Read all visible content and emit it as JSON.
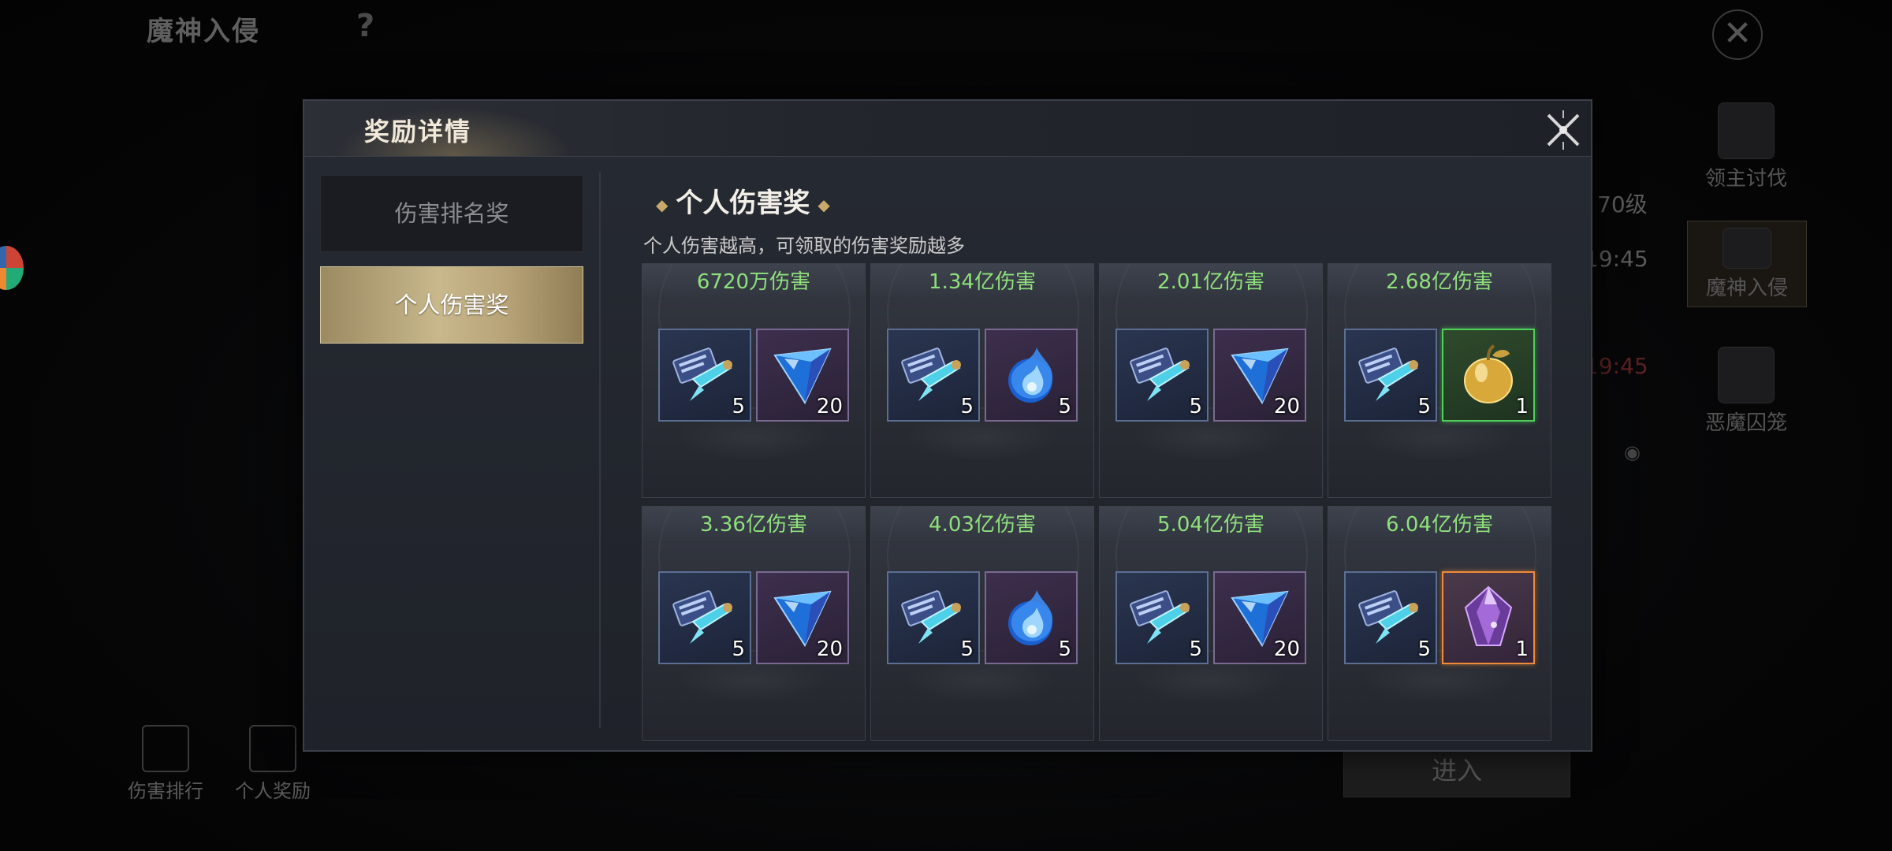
{
  "background": {
    "title": "魔神入侵",
    "help": "?",
    "close": "✕",
    "side_items": [
      {
        "label": "领主讨伐"
      },
      {
        "label": "魔神入侵"
      },
      {
        "label": "恶魔囚笼"
      }
    ],
    "level": "70级",
    "time1": "19:45",
    "time2": "19:45",
    "enter_button": "进入",
    "bottom_items": [
      {
        "label": "伤害排行"
      },
      {
        "label": "个人奖励"
      }
    ]
  },
  "modal": {
    "title": "奖励详情",
    "tabs": [
      {
        "label": "伤害排名奖",
        "active": false
      },
      {
        "label": "个人伤害奖",
        "active": true
      }
    ],
    "section_title": "个人伤害奖",
    "section_desc": "个人伤害越高，可领取的伤害奖励越多",
    "cards": [
      {
        "threshold": "6720万伤害",
        "items": [
          {
            "icon": "scroll-icon",
            "qty": "5"
          },
          {
            "icon": "blue-gem-icon",
            "qty": "20"
          }
        ]
      },
      {
        "threshold": "1.34亿伤害",
        "items": [
          {
            "icon": "scroll-icon",
            "qty": "5"
          },
          {
            "icon": "blue-flame-icon",
            "qty": "5"
          }
        ]
      },
      {
        "threshold": "2.01亿伤害",
        "items": [
          {
            "icon": "scroll-icon",
            "qty": "5"
          },
          {
            "icon": "blue-gem-icon",
            "qty": "20"
          }
        ]
      },
      {
        "threshold": "2.68亿伤害",
        "items": [
          {
            "icon": "scroll-icon",
            "qty": "5"
          },
          {
            "icon": "golden-apple-icon",
            "qty": "1"
          }
        ]
      },
      {
        "threshold": "3.36亿伤害",
        "items": [
          {
            "icon": "scroll-icon",
            "qty": "5"
          },
          {
            "icon": "blue-gem-icon",
            "qty": "20"
          }
        ]
      },
      {
        "threshold": "4.03亿伤害",
        "items": [
          {
            "icon": "scroll-icon",
            "qty": "5"
          },
          {
            "icon": "blue-flame-icon",
            "qty": "5"
          }
        ]
      },
      {
        "threshold": "5.04亿伤害",
        "items": [
          {
            "icon": "scroll-icon",
            "qty": "5"
          },
          {
            "icon": "blue-gem-icon",
            "qty": "20"
          }
        ]
      },
      {
        "threshold": "6.04亿伤害",
        "items": [
          {
            "icon": "scroll-icon",
            "qty": "5"
          },
          {
            "icon": "purple-crystal-icon",
            "qty": "1"
          }
        ]
      }
    ],
    "colors": {
      "threshold_text": "#8fe07c",
      "tab_active": "#c8b88c",
      "rare_green_border": "#4fd05a",
      "rare_orange_border": "#f08a38"
    }
  }
}
